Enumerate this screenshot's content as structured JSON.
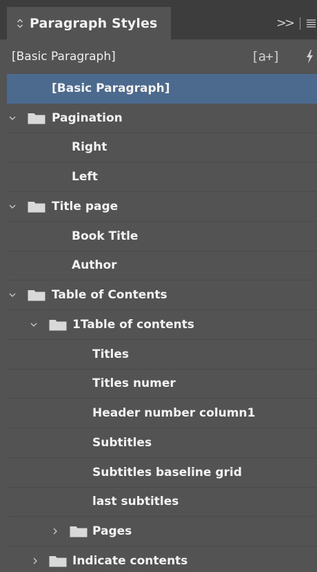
{
  "panel": {
    "tab_title": "Paragraph Styles",
    "expand_label": ">>",
    "current_style": "[Basic Paragraph]",
    "new_override_label": "[a+]"
  },
  "styles": {
    "basic": "[Basic Paragraph]",
    "pagination": "Pagination",
    "right": "Right",
    "left": "Left",
    "title_page": "Title page",
    "book_title": "Book Title",
    "author": "Author",
    "toc": "Table of Contents",
    "toc1": "1Table of contents",
    "titles": "Titles",
    "titles_numer": "Titles numer",
    "header_number": "Header number column1",
    "subtitles": "Subtitles",
    "subtitles_grid": "Subtitles baseline grid",
    "last_subtitles": "last subtitles",
    "pages": "Pages",
    "indicate": "Indicate contents"
  },
  "colors": {
    "panel_bg": "#535353",
    "tab_bar_bg": "#3d3d3d",
    "selected_row": "#4b6a8e",
    "folder": "#d9d9d9",
    "text": "#f3f3f3"
  },
  "icons": {
    "collapse": "diamond-chevrons-icon",
    "menu": "hamburger-menu-icon",
    "override": "bracket-a-plus-icon",
    "lightning": "lightning-icon",
    "folder": "folder-icon",
    "chevron_down": "chevron-down-icon",
    "chevron_right": "chevron-right-icon"
  }
}
